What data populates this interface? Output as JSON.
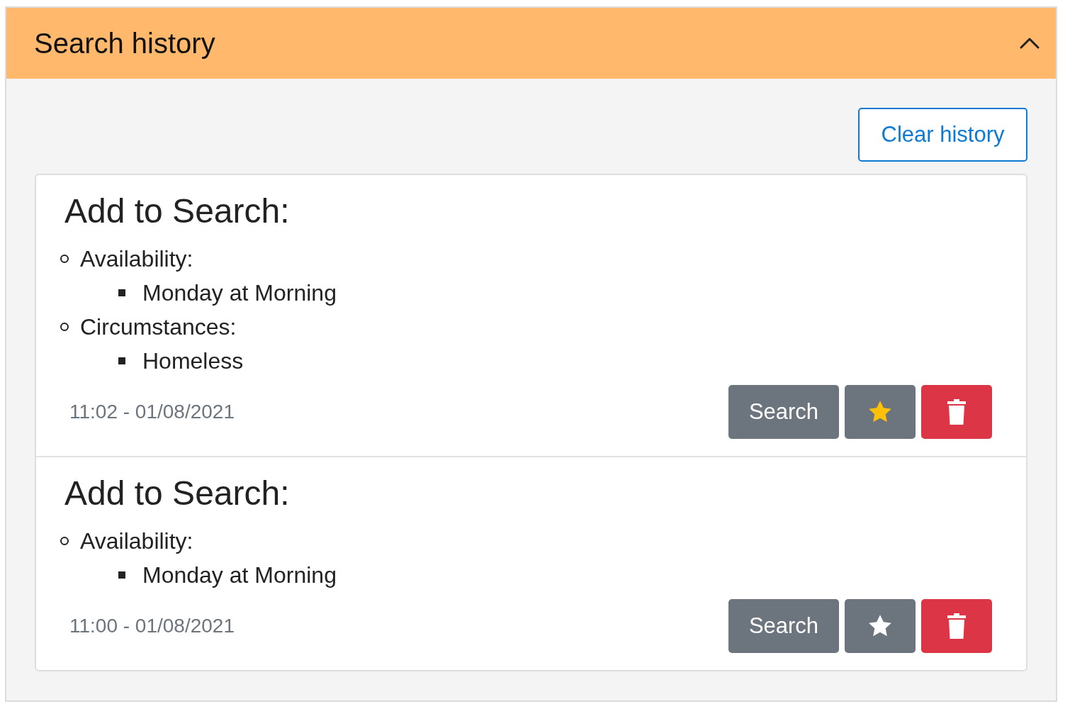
{
  "panel": {
    "title": "Search history",
    "expanded": true
  },
  "clear_button": "Clear history",
  "entries": [
    {
      "heading": "Add to Search:",
      "criteria": [
        {
          "label": "Availability:",
          "children": [
            {
              "label": "Monday at Morning"
            }
          ]
        },
        {
          "label": "Circumstances:",
          "children": [
            {
              "label": "Homeless"
            }
          ]
        }
      ],
      "timestamp": "11:02 - 01/08/2021",
      "search_button": "Search",
      "favorite": true
    },
    {
      "heading": "Add to Search:",
      "criteria": [
        {
          "label": "Availability:",
          "children": [
            {
              "label": "Monday at Morning"
            }
          ]
        }
      ],
      "timestamp": "11:00 - 01/08/2021",
      "search_button": "Search",
      "favorite": false
    }
  ]
}
